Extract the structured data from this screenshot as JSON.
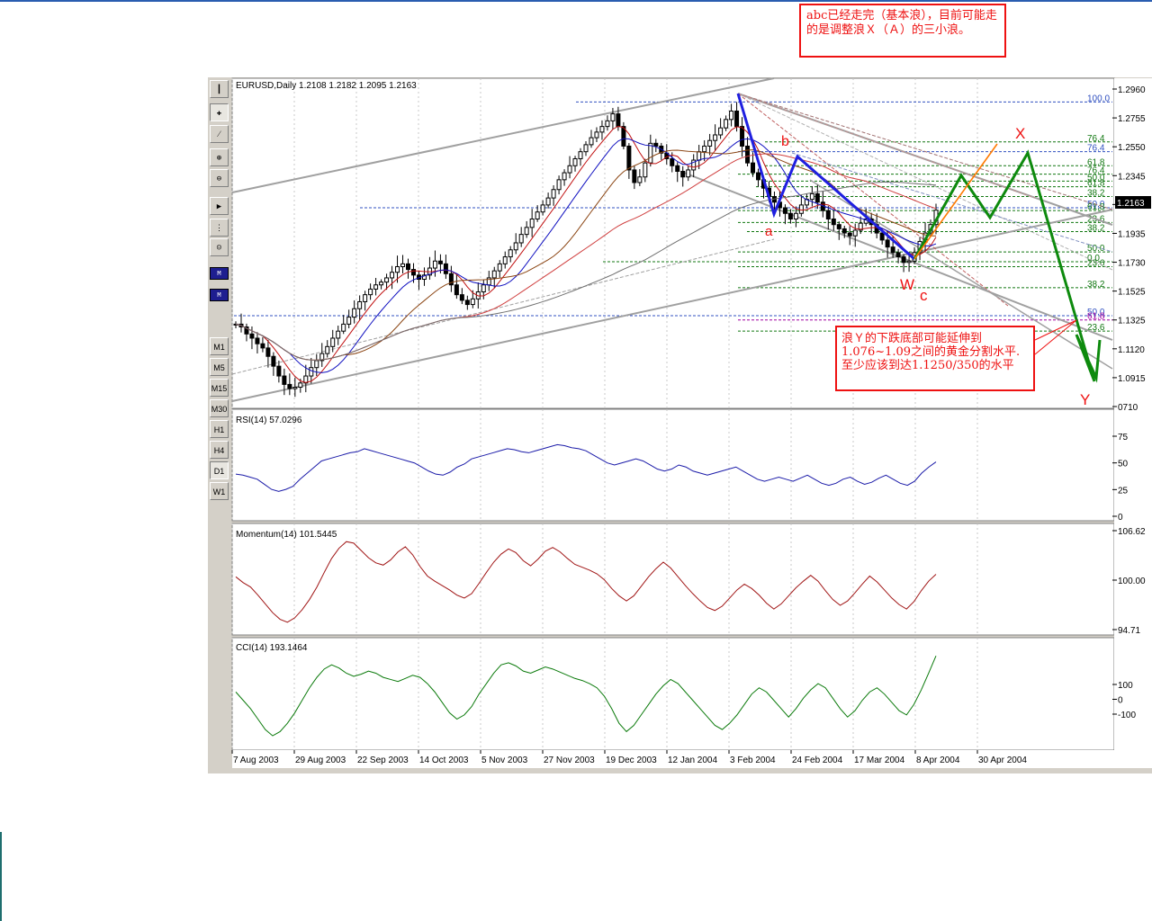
{
  "window": {
    "symbol_header": "EURUSD,Daily  1.2108 1.2182 1.2095 1.2163"
  },
  "toolbar": {
    "tools": [
      "cursor",
      "crosshair",
      "trendline",
      "zoom-in",
      "zoom-out",
      "scroll-right",
      "objects",
      "wizard"
    ],
    "chart_types": [
      "bar-chart",
      "candle-chart"
    ],
    "periods": [
      "M1",
      "M5",
      "M15",
      "M30",
      "H1",
      "H4",
      "D1",
      "W1"
    ],
    "active_period": "D1"
  },
  "annotations": {
    "note_top": "abc已经走完（基本浪），目前可能走的是调整浪Ｘ（Ａ）的三小浪。",
    "note_bottom": "浪Ｙ的下跌底部可能延伸到1.076~1.09之间的黄金分割水平.至少应该到达1.1250/350的水平",
    "wave_labels": {
      "a": "a",
      "b": "b",
      "W": "W",
      "c": "c",
      "X": "X",
      "Y": "Y"
    }
  },
  "colors": {
    "bull": "#000000",
    "bear": "#000000",
    "blue_wave": "#1f1fe0",
    "green_wave": "#0d8a0d",
    "orange": "#ff7a00",
    "red_note": "#ee1111",
    "rsi": "#1a1aa8",
    "momentum": "#a01515",
    "cci": "#0b7a0b"
  },
  "chart_data": [
    {
      "type": "candlestick",
      "title": "EURUSD,Daily  1.2108 1.2182 1.2095 1.2163",
      "ohlc_last": {
        "open": 1.2108,
        "high": 1.2182,
        "low": 1.2095,
        "close": 1.2163
      },
      "y_ticks": [
        "1.2960",
        "1.2755",
        "1.2550",
        "1.2345",
        "1.2163",
        "1.1935",
        "1.1730",
        "1.1525",
        "1.1325",
        "1.1120",
        "1.0915",
        "0710"
      ],
      "ylim": [
        1.0775,
        1.2995
      ],
      "current_price": "1.2163",
      "x_ticks": [
        "7 Aug 2003",
        "29 Aug 2003",
        "22 Sep 2003",
        "14 Oct 2003",
        "5 Nov 2003",
        "27 Nov 2003",
        "19 Dec 2003",
        "12 Jan 2004",
        "3 Feb 2004",
        "24 Feb 2004",
        "17 Mar 2004",
        "8 Apr 2004",
        "30 Apr 2004"
      ],
      "close_path": [
        1.135,
        1.133,
        1.128,
        1.125,
        1.121,
        1.118,
        1.112,
        1.105,
        1.098,
        1.092,
        1.089,
        1.09,
        1.093,
        1.098,
        1.104,
        1.109,
        1.114,
        1.119,
        1.125,
        1.13,
        1.135,
        1.14,
        1.146,
        1.151,
        1.156,
        1.16,
        1.163,
        1.165,
        1.168,
        1.172,
        1.176,
        1.178,
        1.174,
        1.17,
        1.167,
        1.17,
        1.175,
        1.18,
        1.178,
        1.171,
        1.163,
        1.156,
        1.152,
        1.149,
        1.153,
        1.158,
        1.163,
        1.168,
        1.173,
        1.178,
        1.183,
        1.188,
        1.193,
        1.199,
        1.204,
        1.21,
        1.215,
        1.22,
        1.225,
        1.231,
        1.238,
        1.243,
        1.248,
        1.253,
        1.258,
        1.263,
        1.268,
        1.272,
        1.276,
        1.28,
        1.285,
        1.276,
        1.262,
        1.245,
        1.236,
        1.24,
        1.25,
        1.264,
        1.262,
        1.257,
        1.253,
        1.248,
        1.244,
        1.24,
        1.245,
        1.252,
        1.258,
        1.262,
        1.266,
        1.27,
        1.275,
        1.281,
        1.287,
        1.276,
        1.262,
        1.25,
        1.243,
        1.238,
        1.232,
        1.226,
        1.222,
        1.218,
        1.214,
        1.21,
        1.214,
        1.22,
        1.224,
        1.228,
        1.222,
        1.216,
        1.21,
        1.206,
        1.203,
        1.2,
        1.198,
        1.202,
        1.207,
        1.21,
        1.206,
        1.2,
        1.195,
        1.19,
        1.186,
        1.183,
        1.179,
        1.18,
        1.186,
        1.194,
        1.2,
        1.206,
        1.2163
      ],
      "levels": [
        {
          "label": "100.0",
          "value": 1.2935,
          "color": "#3050c0"
        },
        {
          "label": "76.4",
          "value": 1.265,
          "color": "#117711"
        },
        {
          "label": "76.4",
          "value": 1.258,
          "color": "#3050c0"
        },
        {
          "label": "61.8",
          "value": 1.248,
          "color": "#117711"
        },
        {
          "label": "76.4",
          "value": 1.242,
          "color": "#117711"
        },
        {
          "label": "50.0",
          "value": 1.237,
          "color": "#117711"
        },
        {
          "label": "61.8",
          "value": 1.233,
          "color": "#117711"
        },
        {
          "label": "38.2",
          "value": 1.226,
          "color": "#117711"
        },
        {
          "label": "50.0",
          "value": 1.218,
          "color": "#3050c0"
        },
        {
          "label": "61.8",
          "value": 1.216,
          "color": "#117711"
        },
        {
          "label": "23.6",
          "value": 1.2075,
          "color": "#117711"
        },
        {
          "label": "38.2",
          "value": 1.201,
          "color": "#117711"
        },
        {
          "label": "50.0",
          "value": 1.1865,
          "color": "#117711"
        },
        {
          "label": "0.0",
          "value": 1.1795,
          "color": "#117711"
        },
        {
          "label": "23.6",
          "value": 1.176,
          "color": "#117711"
        },
        {
          "label": "38.2",
          "value": 1.161,
          "color": "#117711"
        },
        {
          "label": "50.0",
          "value": 1.141,
          "color": "#3050c0"
        },
        {
          "label": "61.8",
          "value": 1.138,
          "color": "#a000a0"
        },
        {
          "label": "23.6",
          "value": 1.13,
          "color": "#117711"
        }
      ],
      "wave_projection": {
        "blue": [
          [
            1.2935
          ],
          [
            1.206
          ],
          [
            1.242
          ],
          [
            1.177
          ]
        ],
        "green": [
          1.177,
          1.236,
          1.208,
          1.247,
          1.094
        ],
        "orange": [
          1.177,
          1.25
        ]
      }
    },
    {
      "type": "line",
      "title": "RSI(14) 57.0296",
      "y_ticks": [
        "75",
        "50",
        "25",
        "0"
      ],
      "ylim": [
        0,
        100
      ],
      "values": [
        45,
        44,
        42,
        40,
        35,
        30,
        28,
        30,
        33,
        40,
        46,
        52,
        58,
        60,
        62,
        64,
        66,
        67,
        70,
        68,
        66,
        64,
        62,
        60,
        58,
        56,
        52,
        48,
        45,
        44,
        47,
        52,
        55,
        60,
        62,
        64,
        66,
        68,
        70,
        69,
        67,
        66,
        68,
        70,
        72,
        74,
        73,
        71,
        70,
        68,
        64,
        60,
        56,
        54,
        56,
        58,
        60,
        58,
        54,
        50,
        48,
        50,
        54,
        52,
        48,
        46,
        44,
        46,
        48,
        50,
        52,
        48,
        44,
        40,
        38,
        40,
        42,
        40,
        38,
        41,
        44,
        40,
        36,
        34,
        36,
        40,
        42,
        38,
        35,
        37,
        41,
        44,
        40,
        36,
        34,
        38,
        46,
        52,
        57.0296
      ]
    },
    {
      "type": "line",
      "title": "Momentum(14) 101.5445",
      "y_ticks": [
        "106.62",
        "100.00",
        "94.71"
      ],
      "ylim": [
        93.5,
        107.5
      ],
      "values": [
        101.2,
        100.4,
        99.8,
        98.7,
        97.5,
        96.3,
        95.4,
        95.0,
        95.6,
        96.7,
        98.1,
        99.8,
        101.8,
        103.7,
        105.1,
        106.0,
        105.8,
        104.8,
        103.8,
        103.1,
        102.8,
        103.5,
        104.6,
        105.3,
        104.2,
        102.6,
        101.3,
        100.6,
        100.0,
        99.4,
        98.7,
        98.3,
        98.9,
        100.3,
        101.8,
        103.2,
        104.3,
        105.0,
        104.5,
        103.4,
        102.7,
        103.6,
        104.7,
        105.2,
        104.6,
        103.7,
        102.9,
        102.5,
        102.1,
        101.6,
        100.8,
        99.6,
        98.6,
        97.9,
        98.6,
        99.9,
        101.2,
        102.3,
        103.2,
        102.4,
        101.2,
        100.0,
        98.9,
        97.9,
        97.0,
        96.6,
        97.2,
        98.3,
        99.4,
        100.2,
        99.6,
        98.7,
        97.6,
        96.8,
        97.5,
        98.6,
        99.7,
        100.6,
        101.4,
        100.6,
        99.3,
        98.1,
        97.3,
        97.9,
        99.0,
        100.2,
        101.3,
        100.5,
        99.4,
        98.3,
        97.4,
        96.8,
        97.8,
        99.3,
        100.6,
        101.5445
      ]
    },
    {
      "type": "line",
      "title": "CCI(14) 193.1464",
      "y_ticks": [
        "100",
        "0",
        "-100"
      ],
      "ylim": [
        -250,
        250
      ],
      "values": [
        20,
        -20,
        -60,
        -110,
        -160,
        -190,
        -170,
        -130,
        -80,
        -20,
        40,
        90,
        130,
        150,
        135,
        110,
        95,
        105,
        120,
        110,
        90,
        80,
        70,
        85,
        100,
        90,
        60,
        20,
        -30,
        -80,
        -110,
        -90,
        -50,
        10,
        60,
        110,
        150,
        160,
        145,
        120,
        110,
        125,
        140,
        130,
        115,
        100,
        85,
        75,
        60,
        40,
        0,
        -60,
        -130,
        -170,
        -140,
        -90,
        -40,
        10,
        50,
        80,
        60,
        20,
        -20,
        -60,
        -100,
        -140,
        -160,
        -130,
        -90,
        -40,
        10,
        40,
        20,
        -20,
        -60,
        -100,
        -60,
        -10,
        30,
        60,
        40,
        -10,
        -60,
        -100,
        -70,
        -20,
        20,
        40,
        10,
        -30,
        -70,
        -90,
        -40,
        30,
        110,
        193.1464
      ]
    }
  ]
}
